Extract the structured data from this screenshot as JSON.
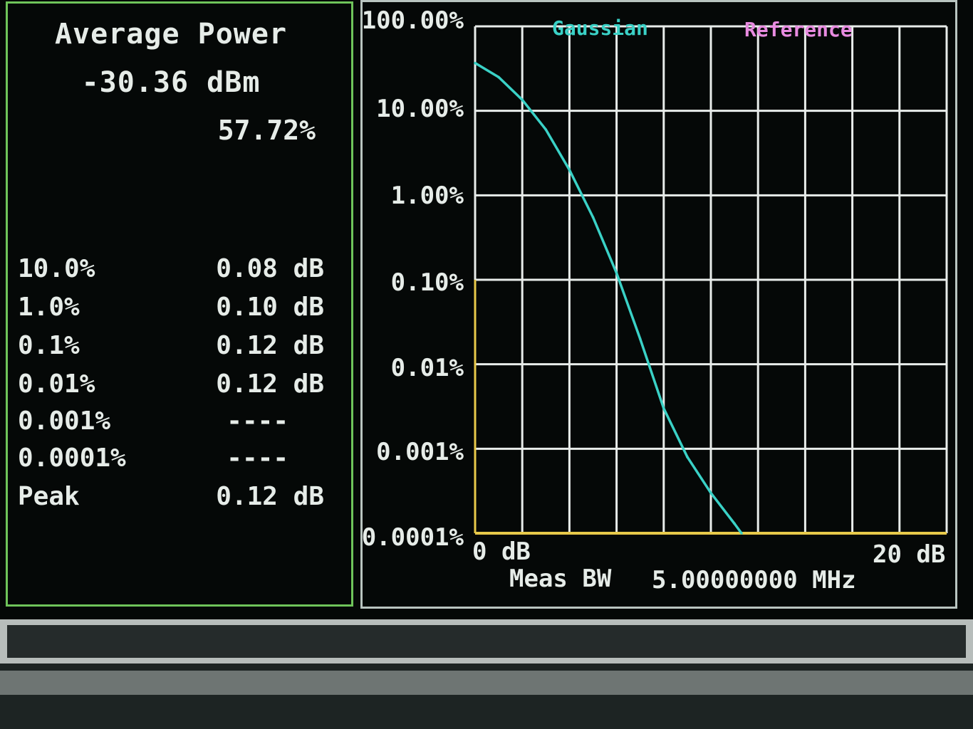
{
  "left_panel": {
    "title": "Average Power",
    "avg_power": "-30.36 dBm",
    "percent": "57.72%",
    "rows": [
      {
        "label": "10.0%",
        "value": "0.08 dB"
      },
      {
        "label": "1.0%",
        "value": "0.10 dB"
      },
      {
        "label": "0.1%",
        "value": "0.12 dB"
      },
      {
        "label": "0.01%",
        "value": "0.12 dB"
      },
      {
        "label": "0.001%",
        "value": "----"
      },
      {
        "label": "0.0001%",
        "value": "----"
      },
      {
        "label": "Peak",
        "value": "0.12 dB"
      }
    ]
  },
  "graph": {
    "legend_gaussian": "Gaussian",
    "legend_reference": "Reference",
    "y_ticks": [
      "100.00%",
      "10.00%",
      "1.00%",
      "0.10%",
      "0.01%",
      "0.001%",
      "0.0001%"
    ],
    "x_min_label": "0 dB",
    "x_max_label": "20 dB",
    "meas_bw_label": "Meas BW",
    "meas_bw_value": "5.00000000 MHz"
  },
  "colors": {
    "trace": "#3ad1c6",
    "gaussian": "#3ad1c6",
    "reference": "#e88be0",
    "grid": "#e8ecea",
    "axis_yellow": "#e8c94a",
    "panel_border_left": "#6fc45a"
  },
  "chart_data": {
    "type": "line",
    "xlabel": "",
    "ylabel": "",
    "xlim": [
      0,
      20
    ],
    "ylim": [
      0.0001,
      100
    ],
    "y_scale": "log",
    "grid": true,
    "legend": [
      "Gaussian",
      "Reference"
    ],
    "series": [
      {
        "name": "Gaussian",
        "x": [
          0,
          1,
          2,
          3,
          4,
          5,
          6,
          7,
          8,
          9,
          10,
          11,
          11.3
        ],
        "y": [
          36.8,
          25,
          13.5,
          6.0,
          2.0,
          0.55,
          0.12,
          0.02,
          0.003,
          0.0008,
          0.0003,
          0.00013,
          0.0001
        ]
      }
    ]
  }
}
